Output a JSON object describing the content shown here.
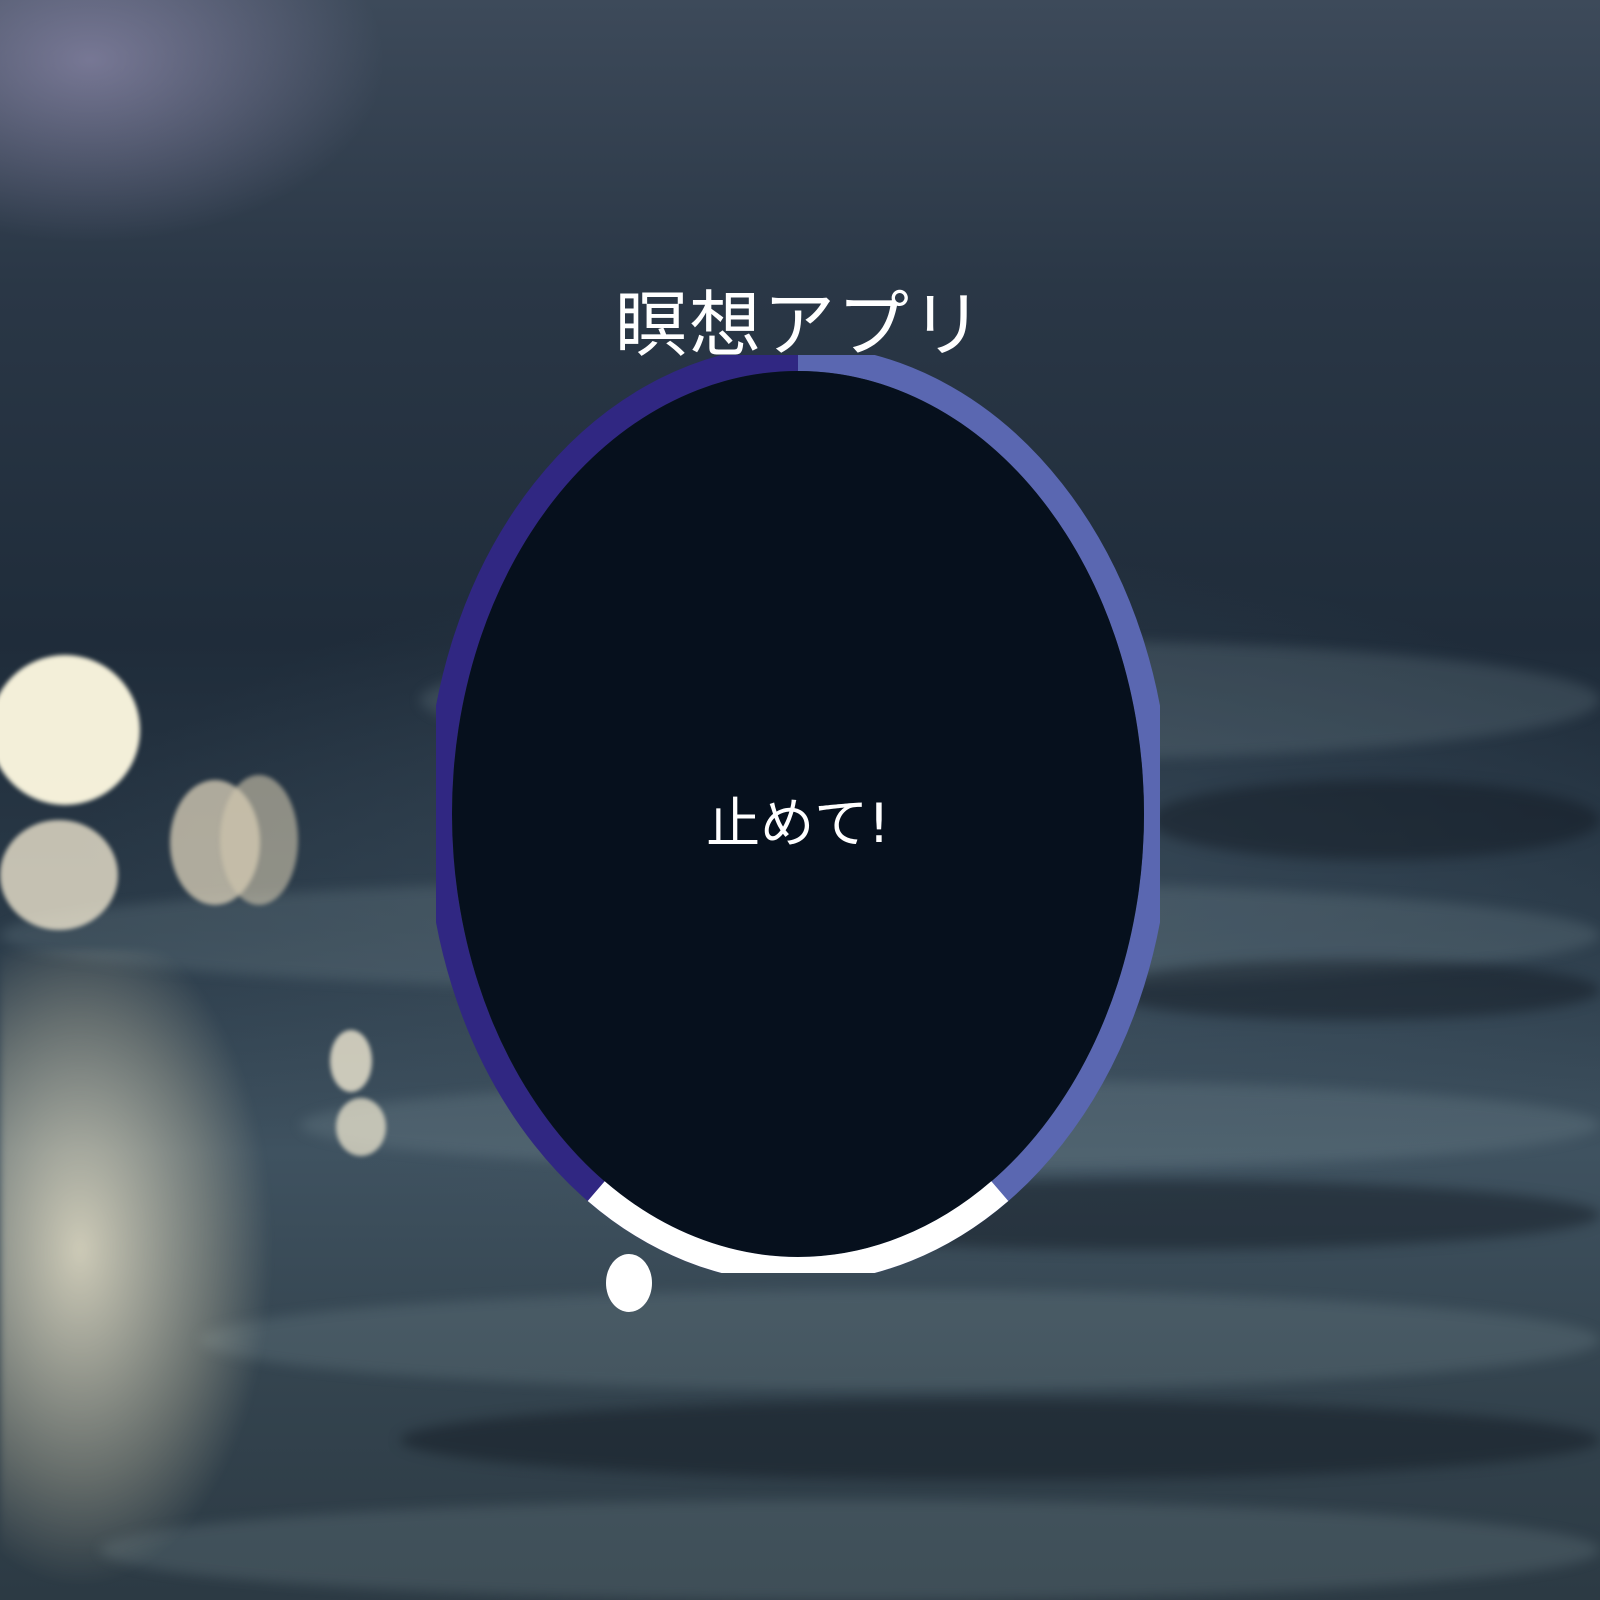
{
  "app": {
    "title": "瞑想アプリ"
  },
  "timer": {
    "button_label": "止めて!",
    "progress_fraction": 0.19,
    "colors": {
      "inner": "#06101d",
      "arc_left": "#302782",
      "arc_right": "#5a67b1",
      "progress": "#ffffff"
    }
  },
  "background": {
    "description_icon": "water-bokeh-background"
  }
}
